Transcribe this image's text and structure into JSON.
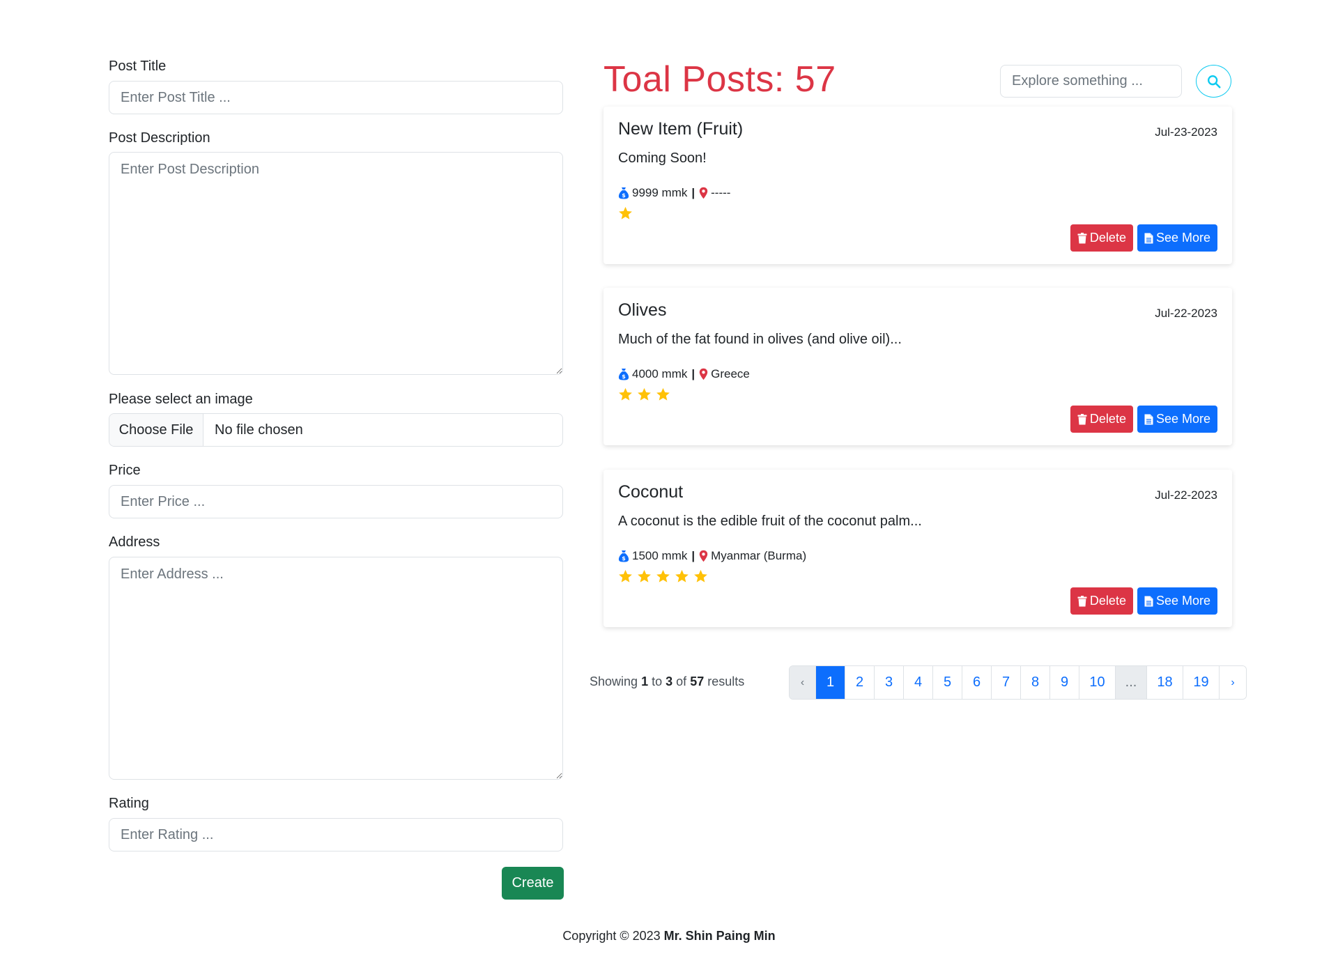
{
  "form": {
    "title_label": "Post Title",
    "title_placeholder": "Enter Post Title ...",
    "description_label": "Post Description",
    "description_placeholder": "Enter Post Description",
    "image_label": "Please select an image",
    "file_button": "Choose File",
    "file_status": "No file chosen",
    "price_label": "Price",
    "price_placeholder": "Enter Price ...",
    "address_label": "Address",
    "address_placeholder": "Enter Address ...",
    "rating_label": "Rating",
    "rating_placeholder": "Enter Rating ...",
    "create_button": "Create"
  },
  "header": {
    "total_label": "Toal Posts: 57",
    "search_placeholder": "Explore something ..."
  },
  "posts": [
    {
      "title": "New Item (Fruit)",
      "date": "Jul-23-2023",
      "description": "Coming Soon!",
      "price": "9999 mmk",
      "location": "-----",
      "rating": 1,
      "delete_label": "Delete",
      "more_label": "See More"
    },
    {
      "title": "Olives",
      "date": "Jul-22-2023",
      "description": "Much of the fat found in olives (and olive oil)...",
      "price": "4000 mmk",
      "location": "Greece",
      "rating": 3,
      "delete_label": "Delete",
      "more_label": "See More"
    },
    {
      "title": "Coconut",
      "date": "Jul-22-2023",
      "description": "A coconut is the edible fruit of the coconut palm...",
      "price": "1500 mmk",
      "location": "Myanmar (Burma)",
      "rating": 5,
      "delete_label": "Delete",
      "more_label": "See More"
    }
  ],
  "pagination": {
    "showing_prefix": "Showing",
    "from": "1",
    "to_word": "to",
    "to": "3",
    "of_word": "of",
    "total": "57",
    "suffix": "results",
    "prev": "‹",
    "next": "›",
    "pages": [
      "1",
      "2",
      "3",
      "4",
      "5",
      "6",
      "7",
      "8",
      "9",
      "10",
      "...",
      "18",
      "19"
    ],
    "current": "1"
  },
  "footer": {
    "text": "Copyright © 2023",
    "author": "Mr. Shin Paing Min"
  },
  "colors": {
    "danger": "#dc3545",
    "primary": "#0d6efd",
    "success": "#198754",
    "info": "#0dcaf0",
    "star": "#ffc107"
  },
  "icons": {
    "search": "search-icon",
    "money": "money-bag-icon",
    "location": "location-pin-icon",
    "star": "star-icon",
    "trash": "trash-icon",
    "file": "file-icon"
  }
}
